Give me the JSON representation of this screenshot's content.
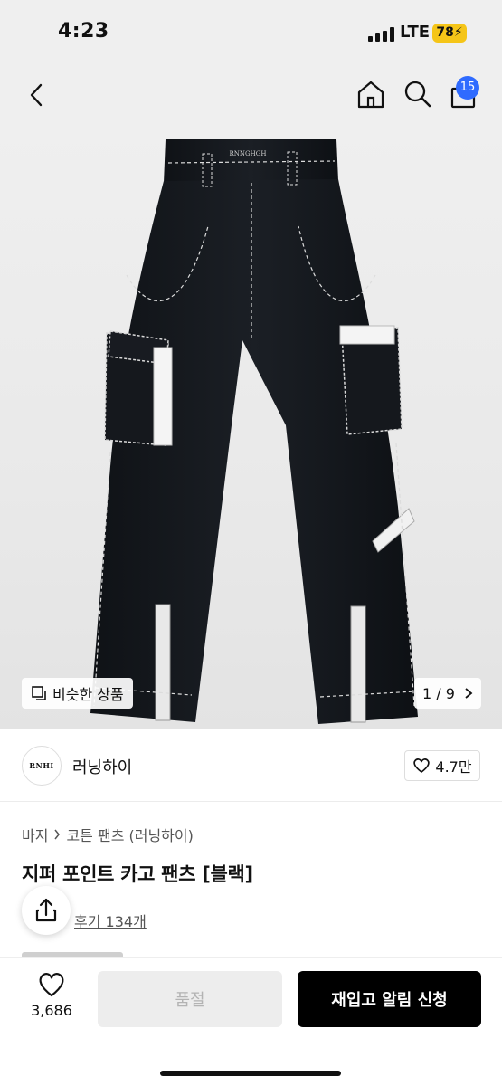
{
  "status_bar": {
    "time": "4:23",
    "network": "LTE",
    "battery": "78"
  },
  "header": {
    "cart_count": "15"
  },
  "product_image": {
    "similar_label": "비슷한 상품",
    "pager_current": "1",
    "pager_separator": "/",
    "pager_total": "9",
    "garment_label": "RNNGHGH"
  },
  "brand": {
    "name": "러닝하이",
    "logo_text": "RNHI",
    "likes": "4.7만"
  },
  "breadcrumb": {
    "category": "바지",
    "subcategory": "코튼 팬츠 (러닝하이)"
  },
  "product": {
    "title": "지퍼 포인트 카고 팬츠 [블랙]",
    "review_link": "후기 134개"
  },
  "bottom_bar": {
    "like_count": "3,686",
    "soldout_label": "품절",
    "restock_label": "재입고 알림 신청"
  },
  "colors": {
    "accent": "#2f6bff",
    "battery": "#f5c518",
    "primary_button": "#000000",
    "disabled_button": "#ededed"
  }
}
